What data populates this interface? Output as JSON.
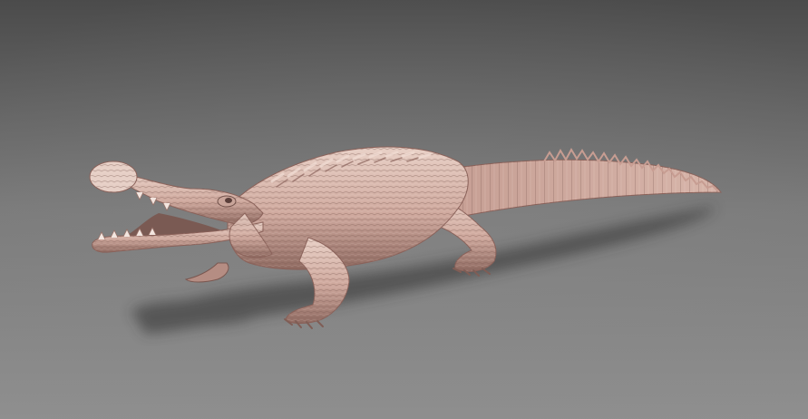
{
  "scene": {
    "subject": "gharial-sculpt",
    "colors": {
      "background_top": "#4b4b4b",
      "background_mid": "#7b7b7b",
      "background_bottom": "#8f8f8f",
      "skin_light": "#e2c7bd",
      "skin_mid": "#c9a196",
      "skin_dark": "#8f6a61",
      "shadow": "#2f2f2f"
    }
  }
}
